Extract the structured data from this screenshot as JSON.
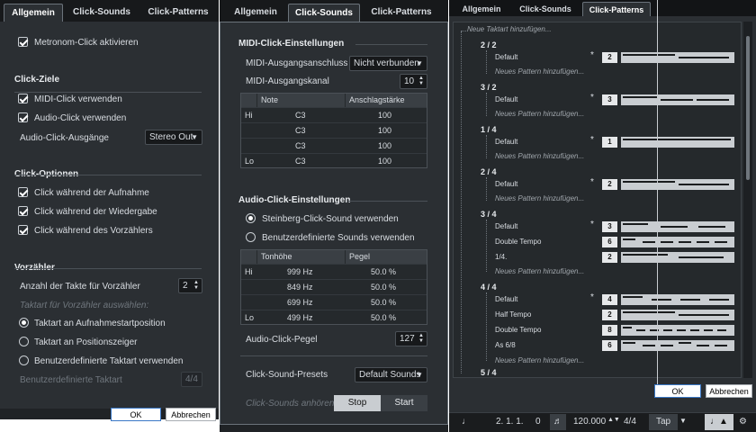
{
  "panel_general": {
    "tabs": [
      "Allgemein",
      "Click-Sounds",
      "Click-Patterns"
    ],
    "metronome_enable": "Metronom-Click aktivieren",
    "targets_title": "Click-Ziele",
    "use_midi": "MIDI-Click verwenden",
    "use_audio": "Audio-Click verwenden",
    "audio_outputs_label": "Audio-Click-Ausgänge",
    "audio_outputs_value": "Stereo Out",
    "options_title": "Click-Optionen",
    "opt_record": "Click während der Aufnahme",
    "opt_playback": "Click während der Wiedergabe",
    "opt_precount": "Click während des Vorzählers",
    "precount_title": "Vorzähler",
    "bars_label": "Anzahl der Takte für Vorzähler",
    "bars_value": "2",
    "time_sig_hint": "Taktart für Vorzähler auswählen:",
    "radio_record_start": "Taktart an Aufnahmestartposition",
    "radio_cursor": "Taktart an Positionszeiger",
    "radio_custom": "Benutzerdefinierte Taktart verwenden",
    "custom_label": "Benutzerdefinierte Taktart",
    "custom_value": "4/4",
    "ok": "OK",
    "cancel": "Abbrechen"
  },
  "panel_sounds": {
    "tabs": [
      "Allgemein",
      "Click-Sounds",
      "Click-Patterns"
    ],
    "midi_title": "MIDI-Click-Einstellungen",
    "midi_out_label": "MIDI-Ausgangsanschluss",
    "midi_out_value": "Nicht verbunden",
    "midi_channel_label": "MIDI-Ausgangskanal",
    "midi_channel_value": "10",
    "midi_table": {
      "headers": [
        "",
        "Note",
        "Anschlagstärke"
      ],
      "rows": [
        [
          "Hi",
          "C3",
          "100"
        ],
        [
          "",
          "C3",
          "100"
        ],
        [
          "",
          "C3",
          "100"
        ],
        [
          "Lo",
          "C3",
          "100"
        ]
      ]
    },
    "audio_title": "Audio-Click-Einstellungen",
    "radio_steinberg": "Steinberg-Click-Sound verwenden",
    "radio_custom": "Benutzerdefinierte Sounds verwenden",
    "audio_table": {
      "headers": [
        "",
        "Tonhöhe",
        "Pegel"
      ],
      "rows": [
        [
          "Hi",
          "999 Hz",
          "50.0 %"
        ],
        [
          "",
          "849 Hz",
          "50.0 %"
        ],
        [
          "",
          "699 Hz",
          "50.0 %"
        ],
        [
          "Lo",
          "499 Hz",
          "50.0 %"
        ]
      ]
    },
    "level_label": "Audio-Click-Pegel",
    "level_value": "127",
    "presets_label": "Click-Sound-Presets",
    "presets_value": "Default Sounds",
    "listen_label": "Click-Sounds anhören",
    "stop": "Stop",
    "start": "Start"
  },
  "panel_patterns": {
    "tabs": [
      "Allgemein",
      "Click-Sounds",
      "Click-Patterns"
    ],
    "new_signature": "Neue Taktart hinzufügen...",
    "new_pattern": "Neues Pattern hinzufügen...",
    "star": "*",
    "groups": [
      {
        "sig": "2 / 2",
        "patterns": [
          {
            "name": "Default",
            "n": "2",
            "star": true
          }
        ]
      },
      {
        "sig": "3 / 2",
        "patterns": [
          {
            "name": "Default",
            "n": "3",
            "star": true
          }
        ]
      },
      {
        "sig": "1 / 4",
        "patterns": [
          {
            "name": "Default",
            "n": "1",
            "star": true
          }
        ]
      },
      {
        "sig": "2 / 4",
        "patterns": [
          {
            "name": "Default",
            "n": "2",
            "star": true
          }
        ]
      },
      {
        "sig": "3 / 4",
        "patterns": [
          {
            "name": "Default",
            "n": "3",
            "star": true
          },
          {
            "name": "Double Tempo",
            "n": "6",
            "star": false
          },
          {
            "name": "1/4.",
            "n": "2",
            "star": false
          }
        ]
      },
      {
        "sig": "4 / 4",
        "patterns": [
          {
            "name": "Default",
            "n": "4",
            "star": true
          },
          {
            "name": "Half Tempo",
            "n": "2",
            "star": false
          },
          {
            "name": "Double Tempo",
            "n": "8",
            "star": false
          },
          {
            "name": "As 6/8",
            "n": "6",
            "star": false
          }
        ]
      },
      {
        "sig": "5 / 4",
        "patterns": []
      }
    ],
    "ok": "OK",
    "cancel": "Abbrechen"
  },
  "transport": {
    "position": "2. 1. 1.",
    "position_tail": "0",
    "tempo": "120.000",
    "signature": "4/4",
    "tap": "Tap"
  },
  "colors": {
    "background": "#2b2f33",
    "tab_bar": "#17191b",
    "accent_button": "#3a78c6"
  }
}
